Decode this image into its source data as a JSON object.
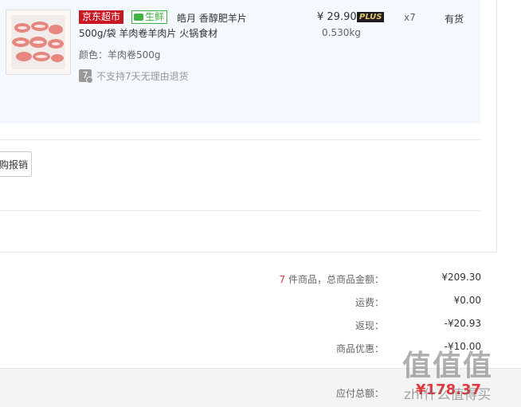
{
  "item": {
    "tag_jd": "京东超市",
    "tag_fresh": "生鲜",
    "title_line1": "皓月 香醇肥羊片",
    "title_line2": "500g/袋 羊肉卷羊肉片 火锅食材",
    "color": "颜色：羊肉卷500g",
    "no_return_icon": "7",
    "no_return_text": "不支持7天无理由退货",
    "price": "¥ 29.90",
    "plus_badge": "PLUS",
    "weight": "0.530kg",
    "qty": "x7",
    "stock": "有货"
  },
  "reimburse_button": "购报销",
  "summary": {
    "count": "7",
    "count_label": " 件商品，总商品金额：",
    "goods_total": "¥209.30",
    "shipping_label": "运费：",
    "shipping": "¥0.00",
    "cashback_label": "返现：",
    "cashback": "-¥20.93",
    "discount_label": "商品优惠：",
    "discount": "-¥10.00",
    "payable_label": "应付总额：",
    "payable": "¥178.37"
  },
  "watermark": {
    "logo": "值值值",
    "site": "zhi什么值得买"
  },
  "colors": {
    "accent_red": "#e4393c",
    "jd_red": "#c81623",
    "fresh_green": "#3fb343",
    "panel_bg": "#f3f9fe"
  }
}
